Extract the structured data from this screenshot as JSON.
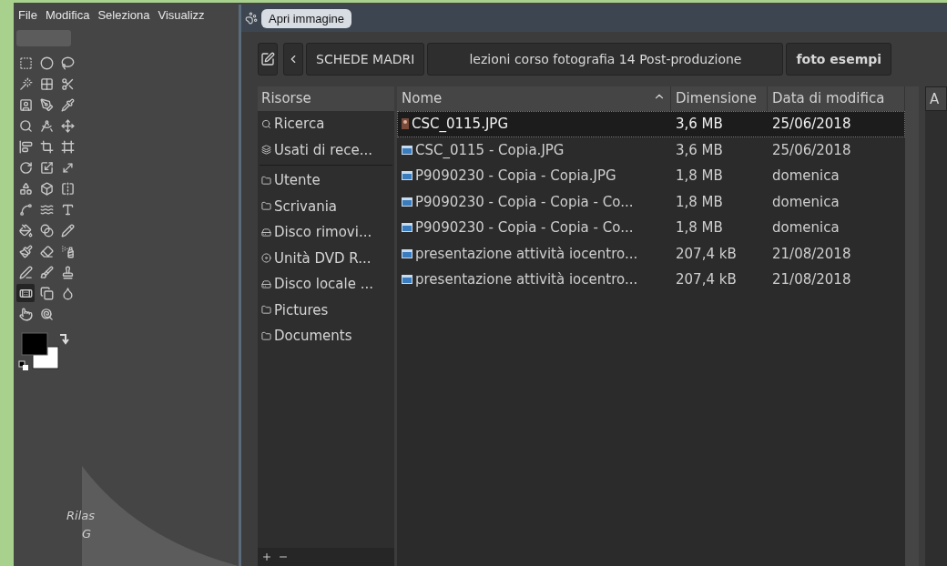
{
  "menu": [
    "File",
    "Modifica",
    "Seleziona",
    "Visualizz"
  ],
  "tools": [
    {
      "selected": false
    },
    {
      "selected": false
    },
    {
      "selected": false
    },
    {
      "selected": false
    },
    {
      "selected": false
    },
    {
      "selected": false
    },
    {
      "selected": false
    },
    {
      "selected": false
    },
    {
      "selected": false
    },
    {
      "selected": false
    },
    {
      "selected": false
    },
    {
      "selected": false
    },
    {
      "selected": false
    },
    {
      "selected": false
    },
    {
      "selected": false
    },
    {
      "selected": false
    },
    {
      "selected": false
    },
    {
      "selected": false
    },
    {
      "selected": false
    },
    {
      "selected": false
    },
    {
      "selected": false
    },
    {
      "selected": false
    },
    {
      "selected": false
    },
    {
      "selected": false
    },
    {
      "selected": false
    },
    {
      "selected": false
    },
    {
      "selected": false
    },
    {
      "selected": false
    },
    {
      "selected": false
    },
    {
      "selected": false
    },
    {
      "selected": false
    },
    {
      "selected": false
    },
    {
      "selected": false
    },
    {
      "selected": true
    },
    {
      "selected": false
    },
    {
      "selected": false
    },
    {
      "selected": false
    },
    {
      "selected": false
    }
  ],
  "canvas_text": [
    "Rilas",
    "G"
  ],
  "dialog": {
    "title": "Apri immagine",
    "path": [
      {
        "label": "SCHEDE MADRI",
        "selected": false
      },
      {
        "label": "lezioni corso fotografia 14 Post-produzione",
        "selected": false
      },
      {
        "label": "foto esempi",
        "selected": true
      }
    ],
    "places": {
      "title": "Risorse",
      "groups": [
        [
          {
            "label": "Ricerca",
            "kind": "search"
          },
          {
            "label": "Usati di rece...",
            "kind": "recent"
          }
        ],
        [
          {
            "label": "Utente",
            "kind": "folder"
          },
          {
            "label": "Scrivania",
            "kind": "folder"
          },
          {
            "label": "Disco rimovi...",
            "kind": "drive"
          },
          {
            "label": "Unità DVD R...",
            "kind": "dvd"
          },
          {
            "label": "Disco locale ...",
            "kind": "drive"
          },
          {
            "label": "Pictures",
            "kind": "folder"
          },
          {
            "label": "Documents",
            "kind": "folder"
          }
        ]
      ]
    },
    "files": {
      "columns": [
        {
          "label": "Nome",
          "sorted": true
        },
        {
          "label": "Dimensione",
          "sorted": false
        },
        {
          "label": "Data di modifica",
          "sorted": false
        }
      ],
      "rows": [
        {
          "name": "CSC_0115.JPG",
          "size": "3,6 MB",
          "date": "25/06/2018",
          "kind": "thumbnail",
          "selected": true
        },
        {
          "name": "CSC_0115 - Copia.JPG",
          "size": "3,6 MB",
          "date": "25/06/2018",
          "kind": "image",
          "selected": false
        },
        {
          "name": "P9090230 - Copia - Copia.JPG",
          "size": "1,8 MB",
          "date": "domenica",
          "kind": "image",
          "selected": false
        },
        {
          "name": "P9090230 - Copia - Copia - Co...",
          "size": "1,8 MB",
          "date": "domenica",
          "kind": "image",
          "selected": false
        },
        {
          "name": "P9090230 - Copia - Copia - Co...",
          "size": "1,8 MB",
          "date": "domenica",
          "kind": "image",
          "selected": false
        },
        {
          "name": "presentazione attività iocentro...",
          "size": "207,4 kB",
          "date": "21/08/2018",
          "kind": "image",
          "selected": false
        },
        {
          "name": "presentazione attività iocentro...",
          "size": "207,4 kB",
          "date": "21/08/2018",
          "kind": "image",
          "selected": false
        }
      ]
    },
    "preview": {
      "title": "A"
    }
  }
}
